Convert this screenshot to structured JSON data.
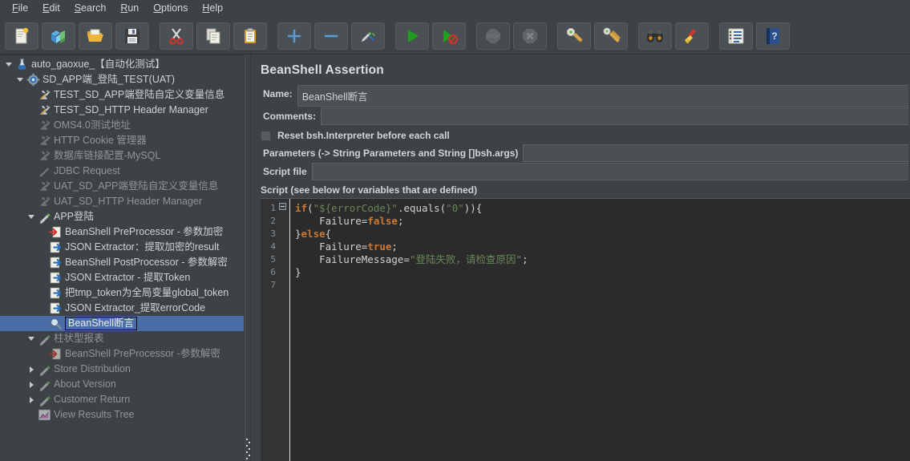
{
  "menu": {
    "items": [
      {
        "label": "File",
        "mnemonic": "F"
      },
      {
        "label": "Edit",
        "mnemonic": "E"
      },
      {
        "label": "Search",
        "mnemonic": "S"
      },
      {
        "label": "Run",
        "mnemonic": "R"
      },
      {
        "label": "Options",
        "mnemonic": "O"
      },
      {
        "label": "Help",
        "mnemonic": "H"
      }
    ]
  },
  "toolbar": {
    "buttons": [
      {
        "name": "new-button",
        "icon": "new-file-icon",
        "enabled": true
      },
      {
        "name": "templates-button",
        "icon": "templates-icon",
        "enabled": true
      },
      {
        "name": "open-button",
        "icon": "open-folder-icon",
        "enabled": true
      },
      {
        "name": "save-button",
        "icon": "save-floppy-icon",
        "enabled": true
      },
      {
        "name": "cut-button",
        "icon": "scissors-icon",
        "enabled": true
      },
      {
        "name": "copy-button",
        "icon": "copy-icon",
        "enabled": true
      },
      {
        "name": "paste-button",
        "icon": "clipboard-icon",
        "enabled": true
      },
      {
        "name": "expand-all-button",
        "icon": "plus-icon",
        "enabled": true
      },
      {
        "name": "collapse-all-button",
        "icon": "minus-icon",
        "enabled": true
      },
      {
        "name": "toggle-button",
        "icon": "toggle-pencils-icon",
        "enabled": true
      },
      {
        "name": "start-button",
        "icon": "play-green-icon",
        "enabled": true
      },
      {
        "name": "start-no-pauses-button",
        "icon": "play-no-pause-icon",
        "enabled": true
      },
      {
        "name": "stop-button",
        "icon": "stop-sign-icon",
        "enabled": false
      },
      {
        "name": "shutdown-button",
        "icon": "shutdown-x-icon",
        "enabled": false
      },
      {
        "name": "clear-button",
        "icon": "clear-broom-icon",
        "enabled": true
      },
      {
        "name": "clear-all-button",
        "icon": "clear-all-broom-icon",
        "enabled": true
      },
      {
        "name": "search-button",
        "icon": "binoculars-icon",
        "enabled": true
      },
      {
        "name": "search-reset-button",
        "icon": "broom-reset-icon",
        "enabled": true
      },
      {
        "name": "function-helper-button",
        "icon": "function-list-icon",
        "enabled": true
      },
      {
        "name": "help-button",
        "icon": "help-book-icon",
        "enabled": true
      }
    ]
  },
  "tree": {
    "nodes": [
      {
        "label": "auto_gaoxue_【自动化测试】",
        "icon": "test-plan-flask-icon",
        "indent": 0,
        "toggle": "open",
        "dim": false,
        "selected": false
      },
      {
        "label": "SD_APP端_登陆_TEST(UAT)",
        "icon": "thread-group-gear-icon",
        "indent": 1,
        "toggle": "open",
        "dim": false,
        "selected": false
      },
      {
        "label": "TEST_SD_APP端登陆自定义变量信息",
        "icon": "config-tools-icon",
        "indent": 2,
        "toggle": "none",
        "dim": false,
        "selected": false
      },
      {
        "label": "TEST_SD_HTTP Header Manager",
        "icon": "config-tools-icon",
        "indent": 2,
        "toggle": "none",
        "dim": false,
        "selected": false
      },
      {
        "label": "OMS4.0测试地址",
        "icon": "config-tools-disabled-icon",
        "indent": 2,
        "toggle": "none",
        "dim": true,
        "selected": false
      },
      {
        "label": "HTTP Cookie 管理器",
        "icon": "config-tools-disabled-icon",
        "indent": 2,
        "toggle": "none",
        "dim": true,
        "selected": false
      },
      {
        "label": "数据库链接配置-MySQL",
        "icon": "config-tools-disabled-icon",
        "indent": 2,
        "toggle": "none",
        "dim": true,
        "selected": false
      },
      {
        "label": "JDBC Request",
        "icon": "jdbc-request-disabled-icon",
        "indent": 2,
        "toggle": "none",
        "dim": true,
        "selected": false
      },
      {
        "label": "UAT_SD_APP端登陆自定义变量信息",
        "icon": "config-tools-disabled-icon",
        "indent": 2,
        "toggle": "none",
        "dim": true,
        "selected": false
      },
      {
        "label": "UAT_SD_HTTP Header Manager",
        "icon": "config-tools-disabled-icon",
        "indent": 2,
        "toggle": "none",
        "dim": true,
        "selected": false
      },
      {
        "label": "APP登陆",
        "icon": "sampler-pencil-icon",
        "indent": 2,
        "toggle": "open",
        "dim": false,
        "selected": false
      },
      {
        "label": "BeanShell PreProcessor - 参数加密",
        "icon": "preprocessor-red-arrow-icon",
        "indent": 3,
        "toggle": "none",
        "dim": false,
        "selected": false
      },
      {
        "label": "JSON Extractor：提取加密的result",
        "icon": "postprocessor-blue-arrow-icon",
        "indent": 3,
        "toggle": "none",
        "dim": false,
        "selected": false
      },
      {
        "label": "BeanShell PostProcessor - 参数解密",
        "icon": "postprocessor-blue-arrow-icon",
        "indent": 3,
        "toggle": "none",
        "dim": false,
        "selected": false
      },
      {
        "label": "JSON Extractor - 提取Token",
        "icon": "postprocessor-blue-arrow-icon",
        "indent": 3,
        "toggle": "none",
        "dim": false,
        "selected": false
      },
      {
        "label": "把tmp_token为全局变量global_token",
        "icon": "postprocessor-blue-arrow-icon",
        "indent": 3,
        "toggle": "none",
        "dim": false,
        "selected": false
      },
      {
        "label": "JSON Extractor_提取errorCode",
        "icon": "postprocessor-blue-arrow-icon",
        "indent": 3,
        "toggle": "none",
        "dim": false,
        "selected": false
      },
      {
        "label": "BeanShell断言",
        "icon": "assertion-magnifier-icon",
        "indent": 3,
        "toggle": "none",
        "dim": false,
        "selected": true
      },
      {
        "label": "柱状型报表",
        "icon": "sampler-pencil-icon",
        "indent": 2,
        "toggle": "open",
        "dim": true,
        "selected": false
      },
      {
        "label": "BeanShell PreProcessor -参数解密",
        "icon": "preprocessor-red-arrow-icon",
        "indent": 3,
        "toggle": "none",
        "dim": true,
        "selected": false
      },
      {
        "label": "Store Distribution",
        "icon": "sampler-pencil-icon",
        "indent": 2,
        "toggle": "closed",
        "dim": true,
        "selected": false
      },
      {
        "label": "About Version",
        "icon": "sampler-pencil-icon",
        "indent": 2,
        "toggle": "closed",
        "dim": true,
        "selected": false
      },
      {
        "label": "Customer Return",
        "icon": "sampler-pencil-icon",
        "indent": 2,
        "toggle": "closed",
        "dim": true,
        "selected": false
      },
      {
        "label": "View Results Tree",
        "icon": "view-results-tree-icon",
        "indent": 2,
        "toggle": "none",
        "dim": true,
        "selected": false
      }
    ]
  },
  "panel": {
    "title": "BeanShell Assertion",
    "name_label": "Name:",
    "name_value": "BeanShell断言",
    "comments_label": "Comments:",
    "comments_value": "",
    "reset_checkbox_label": "Reset bsh.Interpreter before each call",
    "reset_checkbox_checked": false,
    "parameters_label": "Parameters (-> String Parameters and String []bsh.args)",
    "parameters_value": "",
    "script_file_label": "Script file",
    "script_file_value": "",
    "script_label": "Script (see below for variables that are defined)"
  },
  "editor": {
    "line_numbers": [
      "1",
      "2",
      "3",
      "4",
      "5",
      "6",
      "7"
    ],
    "lines": [
      [
        {
          "t": "if",
          "c": "kw"
        },
        {
          "t": "(",
          "c": "pun"
        },
        {
          "t": "\"${errorCode}\"",
          "c": "str"
        },
        {
          "t": ".equals(",
          "c": "id"
        },
        {
          "t": "\"0\"",
          "c": "str"
        },
        {
          "t": ")){",
          "c": "pun"
        }
      ],
      [
        {
          "t": "    Failure=",
          "c": "id"
        },
        {
          "t": "false",
          "c": "kw"
        },
        {
          "t": ";",
          "c": "pun"
        }
      ],
      [
        {
          "t": "}",
          "c": "pun"
        },
        {
          "t": "else",
          "c": "kw"
        },
        {
          "t": "{",
          "c": "pun"
        }
      ],
      [
        {
          "t": "    Failure=",
          "c": "id"
        },
        {
          "t": "true",
          "c": "kw"
        },
        {
          "t": ";",
          "c": "pun"
        }
      ],
      [
        {
          "t": "    FailureMessage=",
          "c": "id"
        },
        {
          "t": "\"登陆失败，请检查原因\"",
          "c": "str"
        },
        {
          "t": ";",
          "c": "pun"
        }
      ],
      [
        {
          "t": "}",
          "c": "pun"
        }
      ],
      []
    ],
    "plain_text": "if(\"${errorCode}\".equals(\"0\")){\n    Failure=false;\n}else{\n    Failure=true;\n    FailureMessage=\"登陆失败，请检查原因\";\n}\n"
  },
  "colors": {
    "window_bg": "#3c4245",
    "editor_bg": "#2b2b2b",
    "selection_blue": "#4a6da7",
    "keyword_orange": "#cc7832",
    "string_green": "#6a8759",
    "text": "#cdd2d5"
  }
}
